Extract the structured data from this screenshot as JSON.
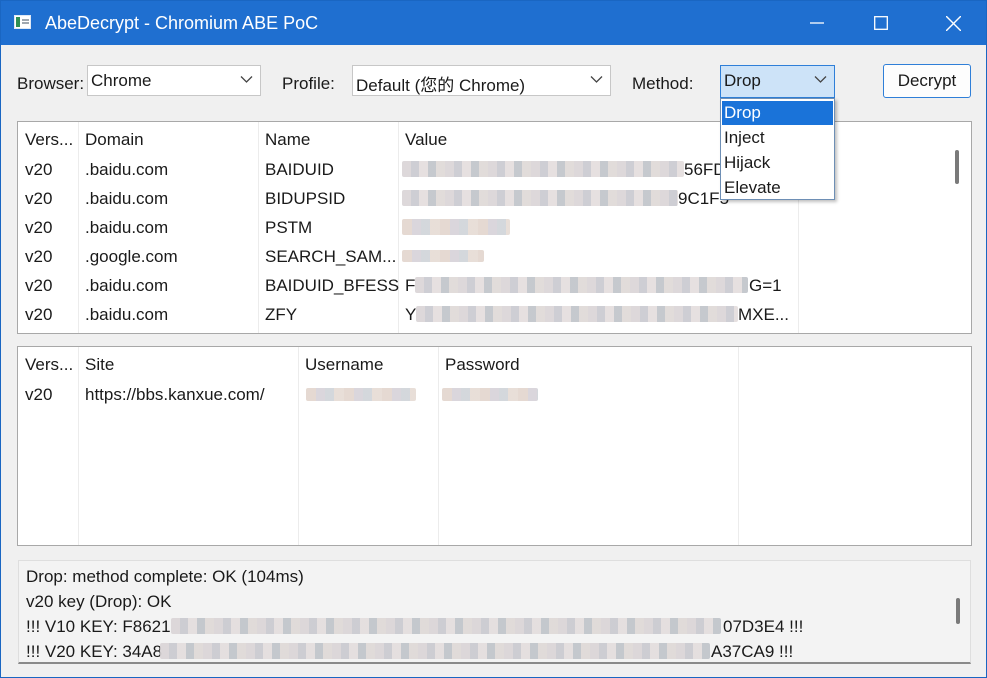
{
  "window": {
    "title": "AbeDecrypt - Chromium ABE PoC",
    "icons": [
      "app-icon",
      "minimize-icon",
      "maximize-icon",
      "close-icon"
    ]
  },
  "toolbar": {
    "browser_label": "Browser:",
    "browser_value": "Chrome",
    "profile_label": "Profile:",
    "profile_value": "Default (您的 Chrome)",
    "method_label": "Method:",
    "method_value": "Drop",
    "decrypt_label": "Decrypt"
  },
  "method_dropdown": {
    "options": [
      "Drop",
      "Inject",
      "Hijack",
      "Elevate"
    ],
    "selected": "Drop"
  },
  "cookies_table": {
    "headers": [
      "Vers...",
      "Domain",
      "Name",
      "Value"
    ],
    "rows": [
      {
        "version": "v20",
        "domain": ".baidu.com",
        "name": "BAIDUID",
        "value_prefix": "",
        "value_suffix": "56FD"
      },
      {
        "version": "v20",
        "domain": ".baidu.com",
        "name": "BIDUPSID",
        "value_prefix": "",
        "value_suffix": "9C1F5"
      },
      {
        "version": "v20",
        "domain": ".baidu.com",
        "name": "PSTM",
        "value_prefix": "",
        "value_suffix": ""
      },
      {
        "version": "v20",
        "domain": ".google.com",
        "name": "SEARCH_SAM...",
        "value_prefix": "",
        "value_suffix": ""
      },
      {
        "version": "v20",
        "domain": ".baidu.com",
        "name": "BAIDUID_BFESS",
        "value_prefix": "F",
        "value_suffix": "G=1"
      },
      {
        "version": "v20",
        "domain": ".baidu.com",
        "name": "ZFY",
        "value_prefix": "Y",
        "value_suffix": "MXE..."
      }
    ]
  },
  "logins_table": {
    "headers": [
      "Vers...",
      "Site",
      "Username",
      "Password"
    ],
    "rows": [
      {
        "version": "v20",
        "site": "https://bbs.kanxue.com/"
      }
    ]
  },
  "log": {
    "lines": [
      "Drop: method complete: OK (104ms)",
      "v20 key (Drop): OK"
    ],
    "v10_prefix": "!!! V10 KEY: F8621",
    "v10_suffix": "07D3E4 !!!",
    "v20_prefix": "!!! V20 KEY: 34A8",
    "v20_suffix": "A37CA9 !!!"
  },
  "colors": {
    "titlebar": "#1f6fd0",
    "accent": "#1a73d9",
    "active_combo": "#cde3f8"
  }
}
